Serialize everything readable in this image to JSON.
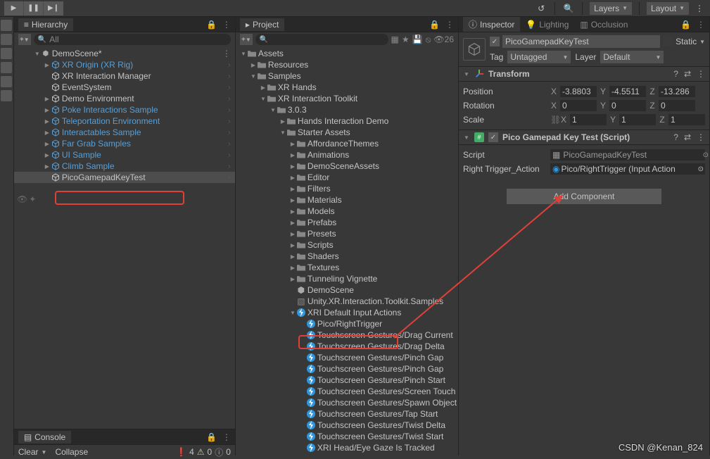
{
  "toolbar": {
    "layers_label": "Layers",
    "layout_label": "Layout"
  },
  "hierarchy": {
    "title": "Hierarchy",
    "search_placeholder": "All",
    "console": "Console",
    "clear": "Clear",
    "collapse": "Collapse",
    "err_count": "4",
    "warn_count": "0",
    "info_count": "0",
    "items": [
      {
        "label": "DemoScene*",
        "indent": 0,
        "fold": "▼",
        "type": "scene"
      },
      {
        "label": "XR Origin (XR Rig)",
        "indent": 1,
        "fold": "▶",
        "type": "link"
      },
      {
        "label": "XR Interaction Manager",
        "indent": 1,
        "fold": "",
        "type": "go"
      },
      {
        "label": "EventSystem",
        "indent": 1,
        "fold": "",
        "type": "go"
      },
      {
        "label": "Demo Environment",
        "indent": 1,
        "fold": "▶",
        "type": "go"
      },
      {
        "label": "Poke Interactions Sample",
        "indent": 1,
        "fold": "▶",
        "type": "link"
      },
      {
        "label": "Teleportation Environment",
        "indent": 1,
        "fold": "▶",
        "type": "link"
      },
      {
        "label": "Interactables Sample",
        "indent": 1,
        "fold": "▶",
        "type": "link"
      },
      {
        "label": "Far Grab Samples",
        "indent": 1,
        "fold": "▶",
        "type": "link"
      },
      {
        "label": "UI Sample",
        "indent": 1,
        "fold": "▶",
        "type": "link"
      },
      {
        "label": "Climb Sample",
        "indent": 1,
        "fold": "▶",
        "type": "link"
      },
      {
        "label": "PicoGamepadKeyTest",
        "indent": 1,
        "fold": "",
        "type": "go",
        "light": true
      }
    ]
  },
  "project": {
    "title": "Project",
    "vis_count": "26",
    "items": [
      {
        "label": "Assets",
        "indent": 0,
        "fold": "▼",
        "type": "folder"
      },
      {
        "label": "Resources",
        "indent": 1,
        "fold": "▶",
        "type": "folder"
      },
      {
        "label": "Samples",
        "indent": 1,
        "fold": "▼",
        "type": "folder"
      },
      {
        "label": "XR Hands",
        "indent": 2,
        "fold": "▶",
        "type": "folder"
      },
      {
        "label": "XR Interaction Toolkit",
        "indent": 2,
        "fold": "▼",
        "type": "folder"
      },
      {
        "label": "3.0.3",
        "indent": 3,
        "fold": "▼",
        "type": "folder"
      },
      {
        "label": "Hands Interaction Demo",
        "indent": 4,
        "fold": "▶",
        "type": "folder"
      },
      {
        "label": "Starter Assets",
        "indent": 4,
        "fold": "▼",
        "type": "folder"
      },
      {
        "label": "AffordanceThemes",
        "indent": 5,
        "fold": "▶",
        "type": "folder"
      },
      {
        "label": "Animations",
        "indent": 5,
        "fold": "▶",
        "type": "folder"
      },
      {
        "label": "DemoSceneAssets",
        "indent": 5,
        "fold": "▶",
        "type": "folder"
      },
      {
        "label": "Editor",
        "indent": 5,
        "fold": "▶",
        "type": "folder"
      },
      {
        "label": "Filters",
        "indent": 5,
        "fold": "▶",
        "type": "folder"
      },
      {
        "label": "Materials",
        "indent": 5,
        "fold": "▶",
        "type": "folder"
      },
      {
        "label": "Models",
        "indent": 5,
        "fold": "▶",
        "type": "folder"
      },
      {
        "label": "Prefabs",
        "indent": 5,
        "fold": "▶",
        "type": "folder"
      },
      {
        "label": "Presets",
        "indent": 5,
        "fold": "▶",
        "type": "folder"
      },
      {
        "label": "Scripts",
        "indent": 5,
        "fold": "▶",
        "type": "folder"
      },
      {
        "label": "Shaders",
        "indent": 5,
        "fold": "▶",
        "type": "folder"
      },
      {
        "label": "Textures",
        "indent": 5,
        "fold": "▶",
        "type": "folder"
      },
      {
        "label": "Tunneling Vignette",
        "indent": 5,
        "fold": "▶",
        "type": "folder"
      },
      {
        "label": "DemoScene",
        "indent": 5,
        "fold": "",
        "type": "scene-asset"
      },
      {
        "label": "Unity.XR.Interaction.Toolkit.Samples",
        "indent": 5,
        "fold": "",
        "type": "asm"
      },
      {
        "label": "XRI Default Input Actions",
        "indent": 5,
        "fold": "▼",
        "type": "input"
      },
      {
        "label": "Pico/RightTrigger",
        "indent": 6,
        "fold": "",
        "type": "action"
      },
      {
        "label": "Touchscreen Gestures/Drag Current",
        "indent": 6,
        "fold": "",
        "type": "action"
      },
      {
        "label": "Touchscreen Gestures/Drag Delta",
        "indent": 6,
        "fold": "",
        "type": "action"
      },
      {
        "label": "Touchscreen Gestures/Pinch Gap",
        "indent": 6,
        "fold": "",
        "type": "action"
      },
      {
        "label": "Touchscreen Gestures/Pinch Gap",
        "indent": 6,
        "fold": "",
        "type": "action"
      },
      {
        "label": "Touchscreen Gestures/Pinch Start",
        "indent": 6,
        "fold": "",
        "type": "action"
      },
      {
        "label": "Touchscreen Gestures/Screen Touch",
        "indent": 6,
        "fold": "",
        "type": "action"
      },
      {
        "label": "Touchscreen Gestures/Spawn Object",
        "indent": 6,
        "fold": "",
        "type": "action"
      },
      {
        "label": "Touchscreen Gestures/Tap Start",
        "indent": 6,
        "fold": "",
        "type": "action"
      },
      {
        "label": "Touchscreen Gestures/Twist Delta",
        "indent": 6,
        "fold": "",
        "type": "action"
      },
      {
        "label": "Touchscreen Gestures/Twist Start",
        "indent": 6,
        "fold": "",
        "type": "action"
      },
      {
        "label": "XRI Head/Eye Gaze Is Tracked",
        "indent": 6,
        "fold": "",
        "type": "action"
      }
    ]
  },
  "inspector": {
    "tab_inspector": "Inspector",
    "tab_lighting": "Lighting",
    "tab_occlusion": "Occlusion",
    "go_name": "PicoGamepadKeyTest",
    "static": "Static",
    "tag_label": "Tag",
    "tag": "Untagged",
    "layer_label": "Layer",
    "layer": "Default",
    "transform": {
      "title": "Transform",
      "position": "Position",
      "px": "-3.8803",
      "py": "-4.5511",
      "pz": "-13.286",
      "rotation": "Rotation",
      "rx": "0",
      "ry": "0",
      "rz": "0",
      "scale": "Scale",
      "sx": "1",
      "sy": "1",
      "sz": "1"
    },
    "script_comp": {
      "title": "Pico Gamepad Key Test (Script)",
      "script_label": "Script",
      "script": "PicoGamepadKeyTest",
      "prop_label": "Right Trigger_Action",
      "prop_val": "Pico/RightTrigger (Input Action"
    },
    "add_component": "Add Component"
  },
  "watermark": "CSDN @Kenan_824"
}
